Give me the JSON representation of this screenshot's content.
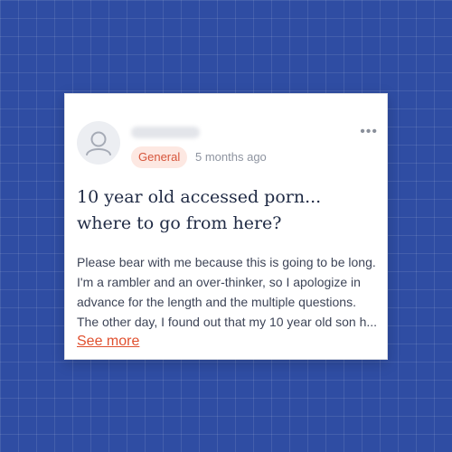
{
  "post": {
    "username": "username",
    "category": "General",
    "time_ago": "5 months ago",
    "title": "10 year old accessed porn... where to go from here?",
    "body": "Please bear with me because this is going to be long. I'm a rambler and an over-thinker, so I apologize in advance for the length and the multiple questions. The other day, I found out that my 10 year old son h...",
    "see_more_label": "See more",
    "more_icon": "more-horizontal-icon",
    "avatar_icon": "user-icon"
  },
  "colors": {
    "background": "#2f4da3",
    "accent": "#e0502f",
    "badge_bg": "#fde8e2",
    "title": "#1f2a44"
  }
}
